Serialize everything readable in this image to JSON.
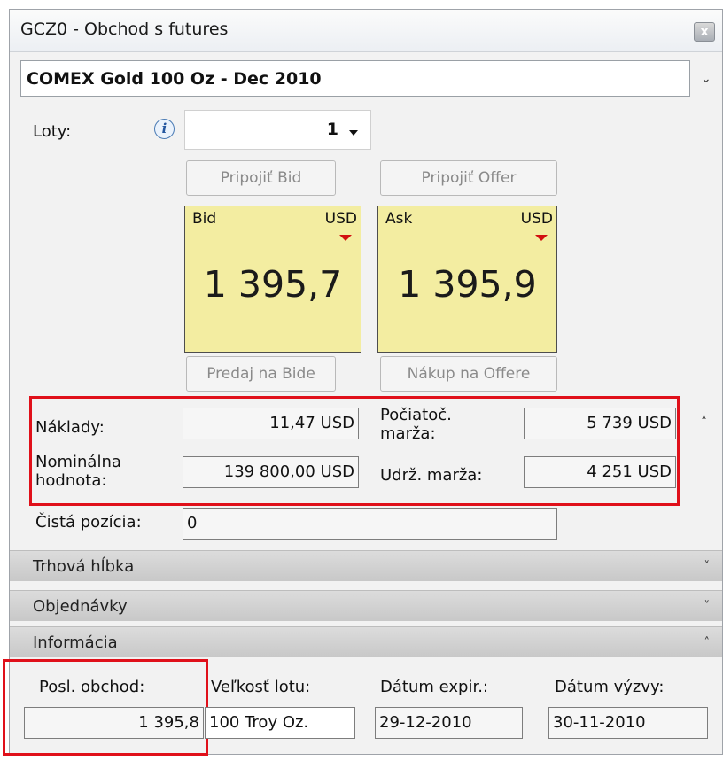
{
  "window": {
    "title": "GCZ0 - Obchod s futures",
    "close_glyph": "x"
  },
  "instrument": {
    "name": "COMEX Gold 100 Oz - Dec 2010",
    "chevron": "⌄"
  },
  "lots": {
    "label": "Loty:",
    "info_glyph": "i",
    "value": "1"
  },
  "buttons": {
    "join_bid": "Pripojiť Bid",
    "join_offer": "Pripojiť Offer",
    "sell_bid": "Predaj na Bide",
    "buy_offer": "Nákup na Offere"
  },
  "quotes": {
    "bid": {
      "label": "Bid",
      "currency": "USD",
      "price": "1 395,7",
      "trend": "down"
    },
    "ask": {
      "label": "Ask",
      "currency": "USD",
      "price": "1 395,9",
      "trend": "down"
    }
  },
  "costs": {
    "costs_label": "Náklady:",
    "costs_value": "11,47 USD",
    "initial_margin_label": "Počiatoč. marža:",
    "initial_margin_value": "5 739 USD",
    "nominal_label": "Nominálna hodnota:",
    "nominal_value": "139 800,00 USD",
    "maintenance_label": "Udrž. marža:",
    "maintenance_value": "4 251 USD",
    "collapse_glyph": "˄"
  },
  "net_position": {
    "label": "Čistá pozícia:",
    "value": "0"
  },
  "sections": {
    "market_depth": "Trhová hĺbka",
    "orders": "Objednávky",
    "information": "Informácia",
    "expand_glyph": "˅",
    "collapse_glyph": "˄"
  },
  "info": {
    "last_trade_label": "Posl. obchod:",
    "last_trade_value": "1 395,8",
    "lot_size_label": "Veľkosť lotu:",
    "lot_size_value": "100 Troy Oz.",
    "expiry_label": "Dátum expir.:",
    "expiry_value": "29-12-2010",
    "call_label": "Dátum výzvy:",
    "call_value": "30-11-2010"
  },
  "colors": {
    "quote_bg": "#f3eda1",
    "highlight": "#e0101a",
    "trend_down": "#d21010"
  }
}
